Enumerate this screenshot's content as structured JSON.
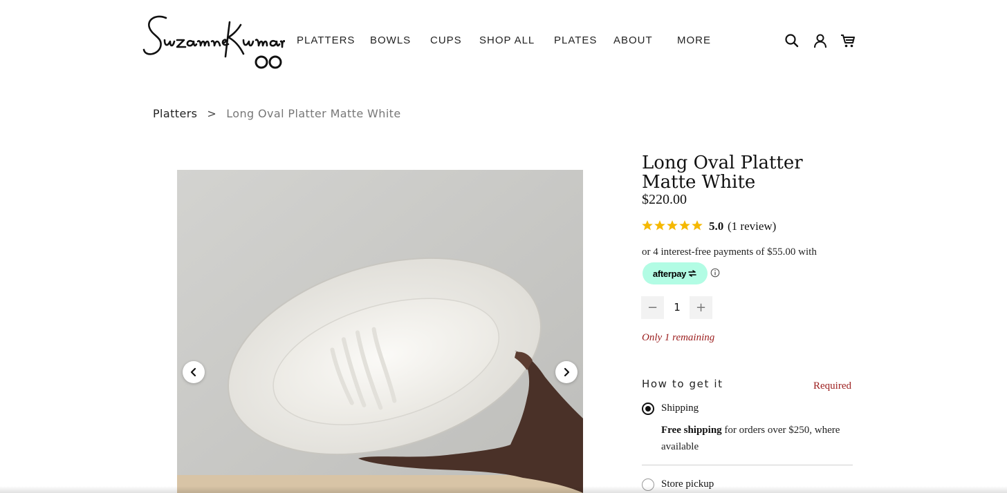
{
  "brand": {
    "logo_text": "Suzanne Kumar"
  },
  "nav": {
    "items": [
      {
        "label": "PLATTERS"
      },
      {
        "label": "BOWLS"
      },
      {
        "label": "CUPS"
      },
      {
        "label": "SHOP ALL"
      },
      {
        "label": "PLATES"
      },
      {
        "label": "ABOUT"
      },
      {
        "label": "MORE"
      }
    ],
    "icons": [
      "search-icon",
      "account-icon",
      "cart-icon"
    ]
  },
  "breadcrumb": {
    "parent": "Platters",
    "separator": ">",
    "current": "Long Oval Platter Matte White"
  },
  "gallery": {
    "prev_icon": "chevron-left-icon",
    "next_icon": "chevron-right-icon"
  },
  "product": {
    "title": "Long Oval Platter Matte White",
    "price": "$220.00",
    "rating": {
      "stars": 5,
      "out_of": 5,
      "value": "5.0",
      "count_text": "(1 review)",
      "star_color": "#f5b800"
    },
    "installments_text": "or 4 interest-free payments of $55.00 with",
    "afterpay": {
      "label": "afterpay",
      "color": "#b2fce4"
    },
    "quantity": {
      "minus": "−",
      "value": "1",
      "plus": "+"
    },
    "stock_text": "Only 1 remaining",
    "alert_color": "#9b1c1c"
  },
  "fulfillment": {
    "title": "How to get it",
    "required_text": "Required",
    "options": [
      {
        "label": "Shipping",
        "selected": true,
        "note_bold": "Free shipping",
        "note_rest": "for orders over $250, where available"
      },
      {
        "label": "Store pickup",
        "selected": false
      }
    ]
  }
}
